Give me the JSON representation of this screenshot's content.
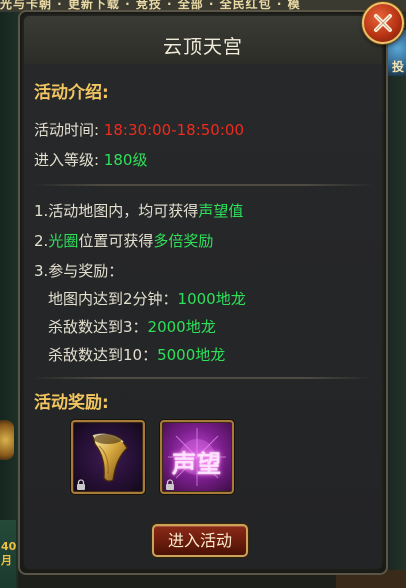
{
  "background": {
    "top_menu_text": "光与卡朝 · 更新下载 · 竞技 · 全部 · 全民红包 · 模",
    "right_badge_text": "投",
    "left_badge_text": "40\n月"
  },
  "dialog": {
    "title": "云顶天宫",
    "intro": {
      "heading": "活动介绍:",
      "time_label": "活动时间:",
      "time_value": "18:30:00-18:50:00",
      "level_label": "进入等级:",
      "level_value": "180级"
    },
    "rules": {
      "rule1_prefix": "1.活动地图内，均可获得",
      "rule1_highlight": "声望值",
      "rule2_prefix": "2.",
      "rule2_highlight1": "光圈",
      "rule2_middle": "位置可获得",
      "rule2_highlight2": "多倍奖励",
      "rule3": "3.参与奖励：",
      "sub1_prefix": "地图内达到2分钟：",
      "sub1_value": "1000地龙",
      "sub2_prefix": "杀敌数达到3：",
      "sub2_value": "2000地龙",
      "sub3_prefix": "杀敌数达到10：",
      "sub3_value": "5000地龙"
    },
    "rewards": {
      "heading": "活动奖励:",
      "items": [
        {
          "name": "horn",
          "icon": "golden-horn-icon"
        },
        {
          "name": "prestige",
          "label": "声望",
          "icon": "prestige-icon"
        }
      ]
    },
    "enter_button_label": "进入活动"
  },
  "colors": {
    "heading": "#f1c560",
    "text": "#e4e0d0",
    "highlight_green": "#2ee05a",
    "highlight_red": "#f12a1e",
    "button_bg": "#7a2212",
    "button_border": "#c9a35a"
  }
}
